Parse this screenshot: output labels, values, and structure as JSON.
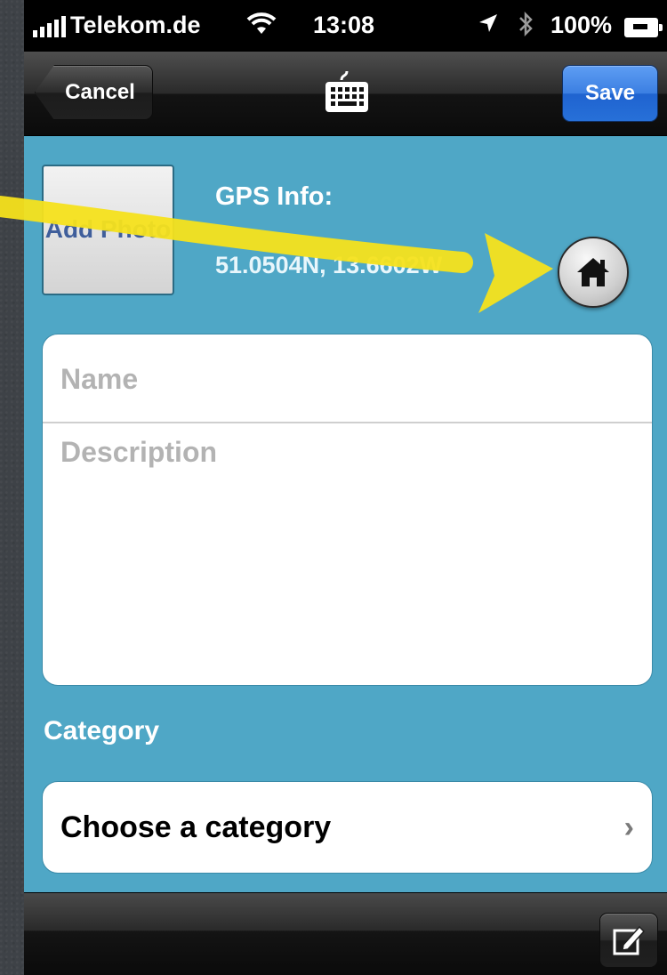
{
  "status_bar": {
    "carrier": "Telekom.de",
    "time": "13:08",
    "battery": "100%",
    "icons": [
      "signal-icon",
      "wifi-icon",
      "location-arrow-icon",
      "bluetooth-icon",
      "battery-charging-icon"
    ]
  },
  "nav": {
    "cancel_label": "Cancel",
    "save_label": "Save",
    "center_icon": "keyboard-icon"
  },
  "gps": {
    "add_photo_label": "Add Photo",
    "title": "GPS Info:",
    "coordinates": "51.0504N, 13.6602W",
    "home_icon": "home-icon"
  },
  "form": {
    "name_placeholder": "Name",
    "description_placeholder": "Description"
  },
  "category": {
    "label": "Category",
    "value": "Choose a category",
    "chevron": "›"
  },
  "toolbar": {
    "compose_icon": "compose-icon"
  },
  "annotation": {
    "arrow_color": "#f5e11c",
    "type": "arrow-pointing-to-home-button"
  },
  "colors": {
    "background": "#4fa7c6",
    "save_button": "#2f76dd",
    "nav_bar": "#1a1a1a"
  }
}
